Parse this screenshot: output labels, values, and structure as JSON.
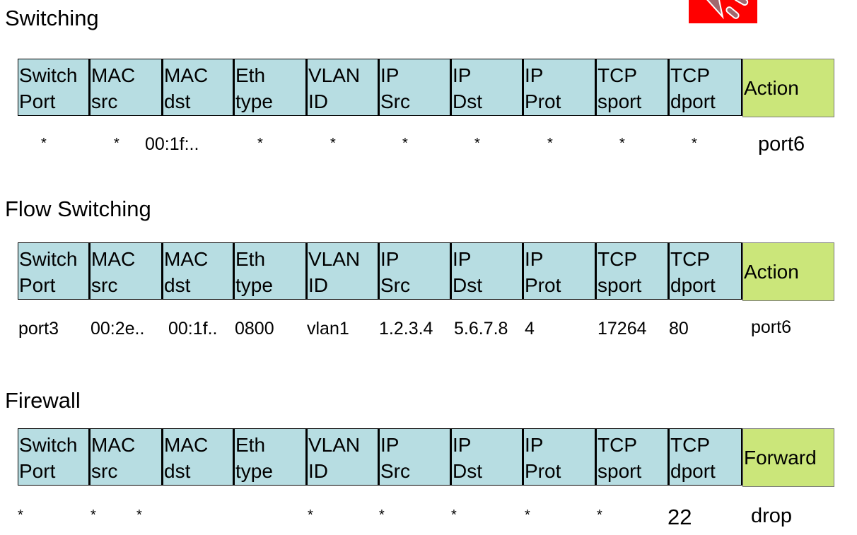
{
  "icon": "megaphone-icon",
  "columns": [
    [
      "Switch",
      "Port"
    ],
    [
      "MAC",
      "src"
    ],
    [
      "MAC",
      "dst"
    ],
    [
      "Eth",
      "type"
    ],
    [
      "VLAN",
      "ID"
    ],
    [
      "IP",
      "Src"
    ],
    [
      "IP",
      "Dst"
    ],
    [
      "IP",
      "Prot"
    ],
    [
      "TCP",
      "sport"
    ],
    [
      "TCP",
      "dport"
    ]
  ],
  "tables": [
    {
      "title": "Switching",
      "action_header": "Action",
      "values": [
        "*",
        "*",
        "00:1f:..",
        "*",
        "*",
        "*",
        "*",
        "*",
        "*",
        "*"
      ],
      "action": "port6"
    },
    {
      "title": "Flow Switching",
      "action_header": "Action",
      "values": [
        "port3",
        "00:2e..",
        "00:1f..",
        "0800",
        "vlan1",
        "1.2.3.4",
        "5.6.7.8",
        "4",
        "17264",
        "80"
      ],
      "action": "port6"
    },
    {
      "title": "Firewall",
      "action_header": "Forward",
      "values": [
        "*",
        "*",
        "*",
        "",
        "*",
        "*",
        "*",
        "*",
        "*",
        "22"
      ],
      "action": "drop"
    }
  ]
}
